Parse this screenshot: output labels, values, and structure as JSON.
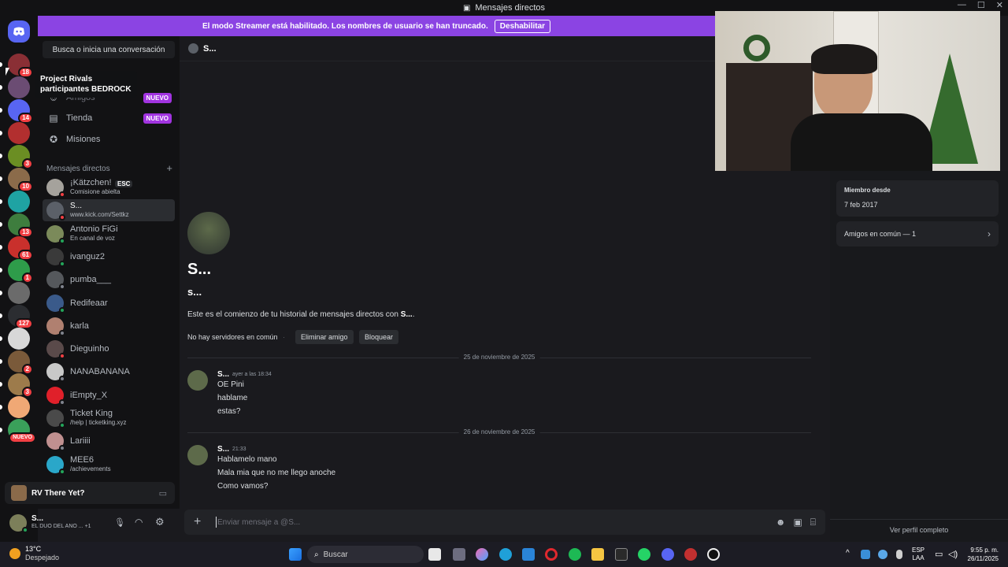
{
  "window": {
    "title": "Mensajes directos"
  },
  "streamer_banner": {
    "text": "El modo Streamer está habilitado. Los nombres de usuario se han truncado.",
    "button": "Deshabilitar"
  },
  "tooltip": {
    "line1": "Project Rivals",
    "line2": "participantes BEDROCK"
  },
  "servers": [
    {
      "badge": "18",
      "color": "#8a2f35"
    },
    {
      "badge": "",
      "color": "#6b4c73"
    },
    {
      "badge": "14",
      "color": "#5865f2"
    },
    {
      "badge": "",
      "color": "#b22f2f"
    },
    {
      "badge": "3",
      "color": "#6b8e23"
    },
    {
      "badge": "10",
      "color": "#8b6b4a"
    },
    {
      "badge": "",
      "color": "#1fa3a3"
    },
    {
      "badge": "13",
      "color": "#3e7d3e"
    },
    {
      "badge": "61",
      "color": "#c9302c"
    },
    {
      "badge": "1",
      "color": "#2e9c4a"
    },
    {
      "badge": "",
      "color": "#6b6b6b"
    },
    {
      "badge": "127",
      "color": "#2b2d31"
    },
    {
      "badge": "",
      "color": "#d8d8d8"
    },
    {
      "badge": "2",
      "color": "#7a5a3a"
    },
    {
      "badge": "3",
      "color": "#9d7b4b"
    },
    {
      "badge": "",
      "color": "#f0a875"
    },
    {
      "badge": "NUEVO",
      "color": "#3aa05a"
    }
  ],
  "search": {
    "label": "Busca o inicia una conversación"
  },
  "nav": {
    "amigos": "Amigos",
    "tienda": "Tienda",
    "misiones": "Misiones",
    "nuevo": "NUEVO"
  },
  "dm_header": {
    "label": "Mensajes directos",
    "add": "+"
  },
  "dms": [
    {
      "name": "¡Kätzchen!",
      "tag": "ESC",
      "sub": "Comisione abielta",
      "color": "#a5a29c",
      "status": "#f23f43"
    },
    {
      "name": "S...",
      "sub": "www.kick.com/Settkz",
      "color": "#5b6068",
      "status": "#f23f43"
    },
    {
      "name": "Antonio FiGi",
      "sub": "En canal de voz",
      "color": "#7b8a5a",
      "status": "#23a55a"
    },
    {
      "name": "ivanguz2",
      "sub": "",
      "color": "#3a3a3a",
      "status": "#23a55a"
    },
    {
      "name": "pumba___",
      "sub": "",
      "color": "#55585c",
      "status": "#80848e"
    },
    {
      "name": "Redifeaar",
      "sub": "",
      "color": "#3a5a8a",
      "status": "#23a55a"
    },
    {
      "name": "karla",
      "sub": "",
      "color": "#b08070",
      "status": "#80848e"
    },
    {
      "name": "Dieguinho",
      "sub": "",
      "color": "#5a4a4a",
      "status": "#f23f43"
    },
    {
      "name": "NANABANANA",
      "sub": "",
      "color": "#c8c8c8",
      "status": "#80848e"
    },
    {
      "name": "iEmpty_X",
      "sub": "",
      "color": "#e0202a",
      "status": "#80848e"
    },
    {
      "name": "Ticket King",
      "sub": "/help | ticketking.xyz",
      "color": "#4a4a4a",
      "status": "#23a55a"
    },
    {
      "name": "Lariiii",
      "sub": "",
      "color": "#c09090",
      "status": "#80848e"
    },
    {
      "name": "MEE6",
      "sub": "/achievements",
      "color": "#2aa7c9",
      "status": "#23a55a"
    }
  ],
  "rv_panel": {
    "label": "RV There Yet?"
  },
  "user_panel": {
    "name": "S...",
    "status": "EL DUO DEL ANO ...",
    "extra": "+1"
  },
  "chat_header": {
    "name": "S..."
  },
  "chat_intro": {
    "display_name": "S...",
    "username": "s...",
    "intro_prefix": "Este es el comienzo de tu historial de mensajes directos con ",
    "intro_name": "S...",
    "intro_suffix": ".",
    "no_servers": "No hay servidores en común",
    "dot": "·",
    "remove_friend": "Eliminar amigo",
    "block": "Bloquear"
  },
  "messages": [
    {
      "date": "25 de noviembre de 2025",
      "author": "S...",
      "time": "ayer a las 18:34",
      "lines": [
        "OE Pini",
        "hablame",
        "estas?"
      ]
    },
    {
      "date": "26 de noviembre de 2025",
      "author": "S...",
      "time": "21:33",
      "lines": [
        "Hablamelo mano",
        "Mala mia que no me llego anoche",
        "Como vamos?"
      ]
    }
  ],
  "composer": {
    "placeholder": "Enviar mensaje a @S..."
  },
  "profile": {
    "member_since_label": "Miembro desde",
    "member_since_value": "7 feb 2017",
    "mutual_friends": "Amigos en común — 1",
    "full_profile": "Ver perfil completo"
  },
  "taskbar": {
    "weather_temp": "13°C",
    "weather_desc": "Despejado",
    "search": "Buscar",
    "lang1": "ESP",
    "lang2": "LAA",
    "time": "9:55 p. m.",
    "date": "26/11/2025"
  }
}
